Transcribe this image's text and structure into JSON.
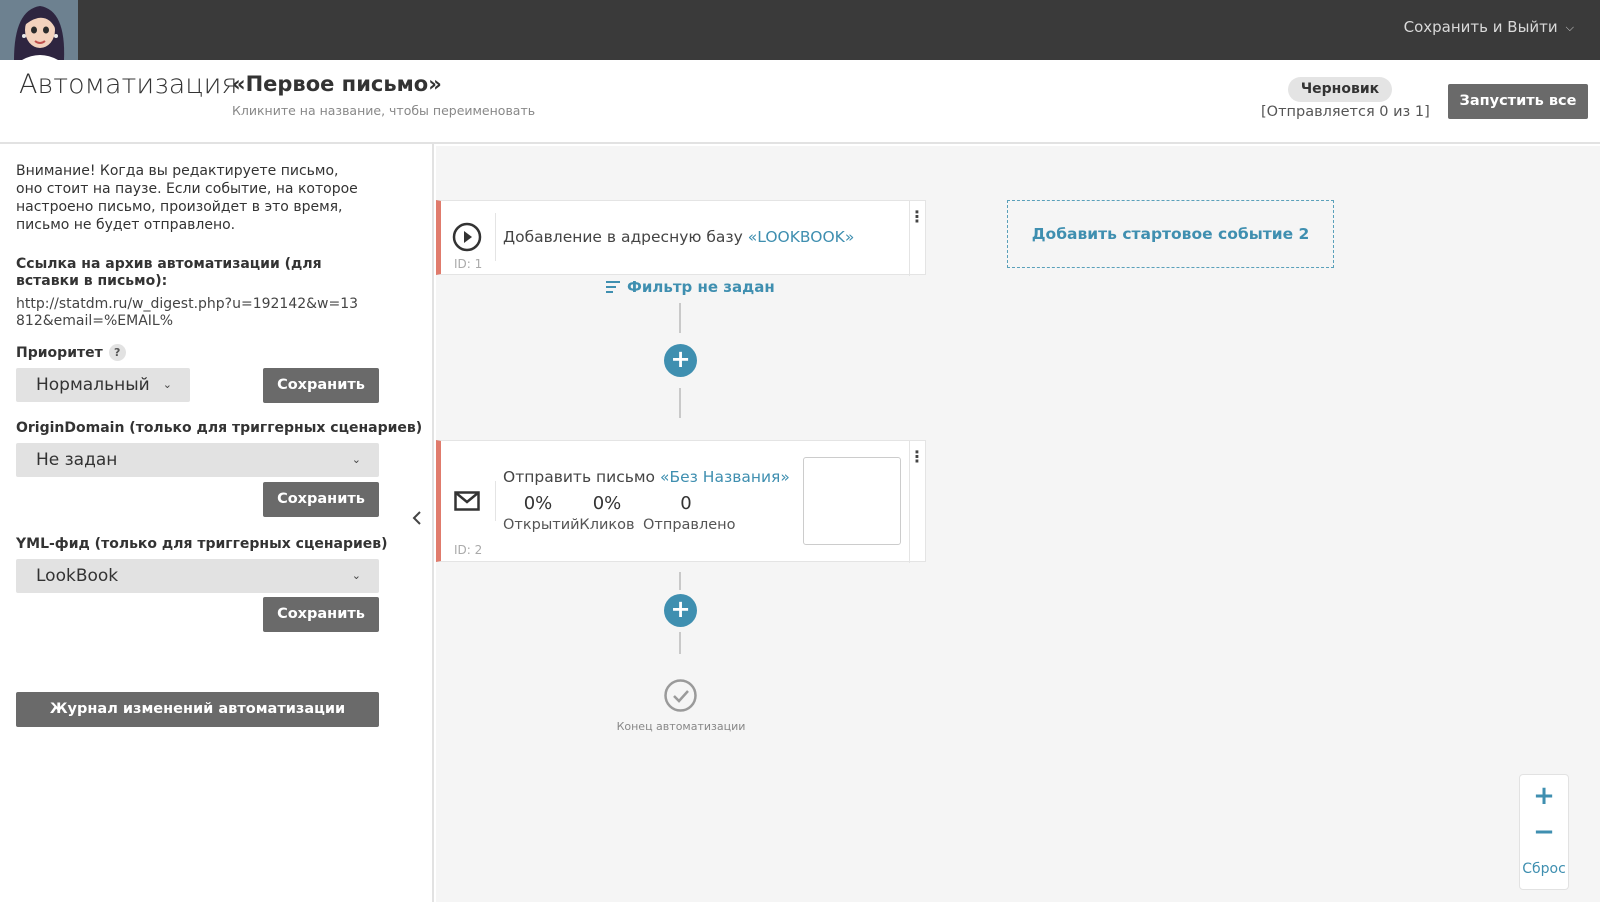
{
  "topbar": {
    "save_exit_label": "Сохранить и Выйти"
  },
  "header": {
    "page_title": "Автоматизация",
    "automation_name": "«Первое письмо»",
    "rename_hint": "Кликните на название, чтобы переименовать",
    "status_badge": "Черновик",
    "sending_status": "[Отправляется 0 из 1]",
    "run_all_label": "Запустить все"
  },
  "sidebar": {
    "warning": "Внимание! Когда вы редактируете письмо, оно стоит на паузе. Если событие, на которое настроено письмо, произойдет в это время, письмо не будет отправлено.",
    "archive_label": "Ссылка на архив автоматизации (для вставки в письмо):",
    "archive_url": "http://statdm.ru/w_digest.php?u=192142&w=13812&email=%EMAIL%",
    "priority": {
      "label": "Приоритет",
      "help": "?",
      "value": "Нормальный",
      "save_label": "Сохранить"
    },
    "origin_domain": {
      "label": "OriginDomain (только для триггерных сценариев)",
      "value": "Не задан",
      "save_label": "Сохранить"
    },
    "yml_feed": {
      "label": "YML-фид (только для триггерных сценариев)",
      "value": "LookBook",
      "save_label": "Сохранить"
    },
    "journal_label": "Журнал изменений автоматизации"
  },
  "canvas": {
    "start_node": {
      "text": "Добавление в адресную базу",
      "link": "«LOOKBOOK»",
      "id": "ID: 1"
    },
    "filter_label": "Фильтр не задан",
    "email_node": {
      "text": "Отправить письмо",
      "link": "«Без Названия»",
      "id": "ID: 2",
      "stats": [
        {
          "value": "0%",
          "label": "Открытий"
        },
        {
          "value": "0%",
          "label": "Кликов"
        },
        {
          "value": "0",
          "label": "Отправлено"
        }
      ]
    },
    "end_label": "Конец автоматизации",
    "add_start_label": "Добавить стартовое событие 2",
    "zoom": {
      "in": "+",
      "out": "−",
      "reset": "Сброс"
    }
  },
  "colors": {
    "accent": "#3f8fb0",
    "node_border": "#e07b6c",
    "button": "#6a6a6a",
    "topbar": "#3a3a3a"
  }
}
